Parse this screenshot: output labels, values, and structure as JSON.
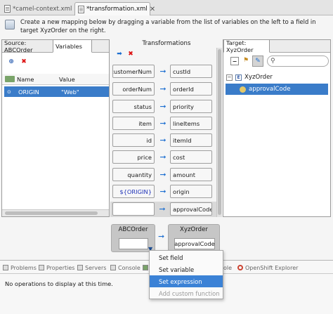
{
  "editor_tabs": [
    {
      "label": "*camel-context.xml",
      "active": false
    },
    {
      "label": "*transformation.xml",
      "active": true
    }
  ],
  "instruction": "Create a new mapping below by dragging a variable from the list of variables on the left to a field in target XyzOrder on the right.",
  "source": {
    "tabs": [
      "Source: ABCOrder",
      "Variables"
    ],
    "selected_tab": "Variables",
    "icons": [
      "add-variable-icon",
      "delete-icon"
    ],
    "columns": [
      "Name",
      "Value"
    ],
    "rows": [
      {
        "name": "ORIGIN",
        "value": "\"Web\"",
        "selected": true
      }
    ]
  },
  "transformations": {
    "title": "Transformations",
    "icons": [
      "add-mapping-icon",
      "delete-icon"
    ],
    "mappings": [
      {
        "source": "customerNum",
        "target": "custId"
      },
      {
        "source": "orderNum",
        "target": "orderId"
      },
      {
        "source": "status",
        "target": "priority"
      },
      {
        "source": "item",
        "target": "lineItems"
      },
      {
        "source": "id",
        "target": "itemId"
      },
      {
        "source": "price",
        "target": "cost"
      },
      {
        "source": "quantity",
        "target": "amount"
      },
      {
        "source": "${ORIGIN}",
        "target": "origin",
        "variable": true
      },
      {
        "source": "",
        "target": "approvalCode",
        "selected": true
      }
    ]
  },
  "target": {
    "tab": "Target: XyzOrder",
    "search_placeholder": "",
    "tree": [
      {
        "label": "XyzOrder",
        "expanded": true,
        "level": 0
      },
      {
        "label": "approvalCode",
        "level": 1,
        "selected": true
      }
    ]
  },
  "details": {
    "source_title": "ABCOrder",
    "source_value": "",
    "target_title": "XyzOrder",
    "target_value": "approvalCode"
  },
  "context_menu": [
    {
      "label": "Set field",
      "state": "normal"
    },
    {
      "label": "Set variable",
      "state": "normal"
    },
    {
      "label": "Set expression",
      "state": "highlighted"
    },
    {
      "label": "Add custom function",
      "state": "disabled"
    }
  ],
  "views": {
    "tabs": [
      "Problems",
      "Properties",
      "Servers",
      "Console",
      "",
      "Operations",
      "ole",
      "OpenShift Explorer"
    ],
    "message": "No operations to display at this time."
  },
  "colors": {
    "selection": "#3a7cc9",
    "menu_highlight": "#3b82d6",
    "arrow": "#1d6fd1",
    "variable_text": "#1f33b8"
  }
}
